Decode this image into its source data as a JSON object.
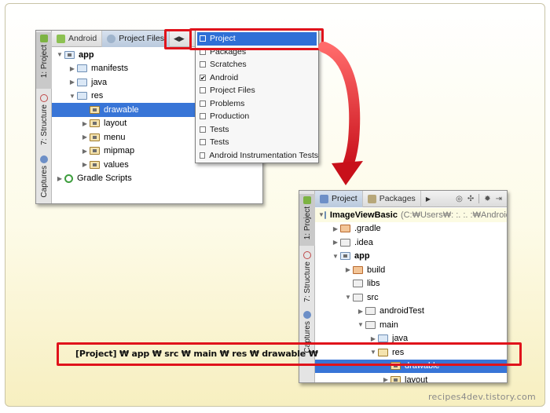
{
  "watermark": "recipes4dev.tistory.com",
  "top_window": {
    "side_tabs": [
      "1: Project",
      "7: Structure",
      "Captures"
    ],
    "tabs": [
      "Android",
      "Project Files"
    ],
    "tree": [
      {
        "label": "app",
        "bold": true
      },
      {
        "label": "manifests"
      },
      {
        "label": "java"
      },
      {
        "label": "res"
      },
      {
        "label": "drawable"
      },
      {
        "label": "layout"
      },
      {
        "label": "menu"
      },
      {
        "label": "mipmap"
      },
      {
        "label": "values"
      },
      {
        "label": "Gradle Scripts"
      }
    ]
  },
  "dropdown": {
    "items": [
      {
        "label": "Project",
        "checked": false,
        "selected": true
      },
      {
        "label": "Packages",
        "checked": false
      },
      {
        "label": "Scratches",
        "checked": false
      },
      {
        "label": "Android",
        "checked": true
      },
      {
        "label": "Project Files",
        "checked": false
      },
      {
        "label": "Problems",
        "checked": false
      },
      {
        "label": "Production",
        "checked": false
      },
      {
        "label": "Tests",
        "checked": false
      },
      {
        "label": "Tests",
        "checked": false
      },
      {
        "label": "Android Instrumentation Tests",
        "checked": false
      }
    ]
  },
  "bottom_window": {
    "side_tabs": [
      "1: Project",
      "7: Structure",
      "Captures"
    ],
    "tabs": [
      "Project",
      "Packages"
    ],
    "root_label": "ImageViewBasic",
    "root_path": "(C:₩Users₩: :. :.  :₩AndroidSt",
    "tree": [
      {
        "label": ".gradle"
      },
      {
        "label": ".idea"
      },
      {
        "label": "app",
        "bold": true
      },
      {
        "label": "build"
      },
      {
        "label": "libs"
      },
      {
        "label": "src"
      },
      {
        "label": "androidTest"
      },
      {
        "label": "main"
      },
      {
        "label": "java"
      },
      {
        "label": "res"
      },
      {
        "label": "drawable"
      },
      {
        "label": "layout"
      }
    ]
  },
  "path_label": "[Project] ₩ app ₩ src ₩ main ₩ res ₩ drawable ₩",
  "colors": {
    "highlight_red": "#e0131b",
    "selection_blue": "#3875d7",
    "arrow_red": "#d9141c"
  }
}
